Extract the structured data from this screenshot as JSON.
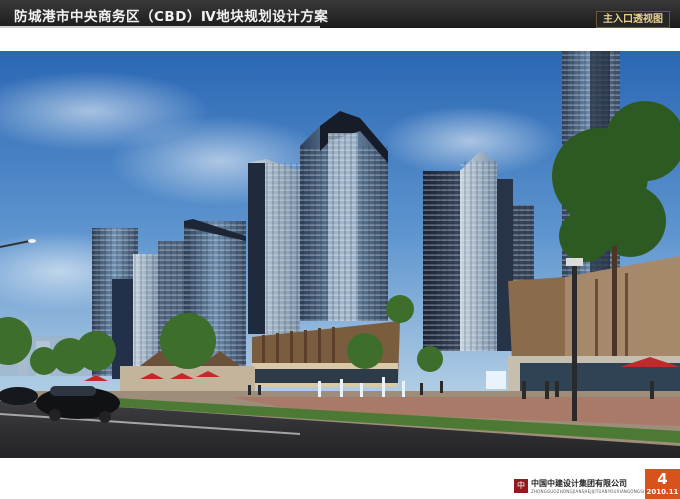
{
  "header": {
    "title": "防城港市中央商务区（CBD）Ⅳ地块规划设计方案",
    "view_label": "主入口透视图"
  },
  "footer": {
    "logo": "中",
    "company": "中国中建设计集团有限公司",
    "company_en": "ZHONGGUOZHONGJIANSHEJIJITUANYOUXIANGONGSI",
    "page_number": "4",
    "date": "2010.11"
  },
  "colors": {
    "header_bg": "#1f1f1f",
    "view_label_text": "#e8d28c",
    "badge": "#d8531c",
    "sky": "#3b78c2"
  }
}
